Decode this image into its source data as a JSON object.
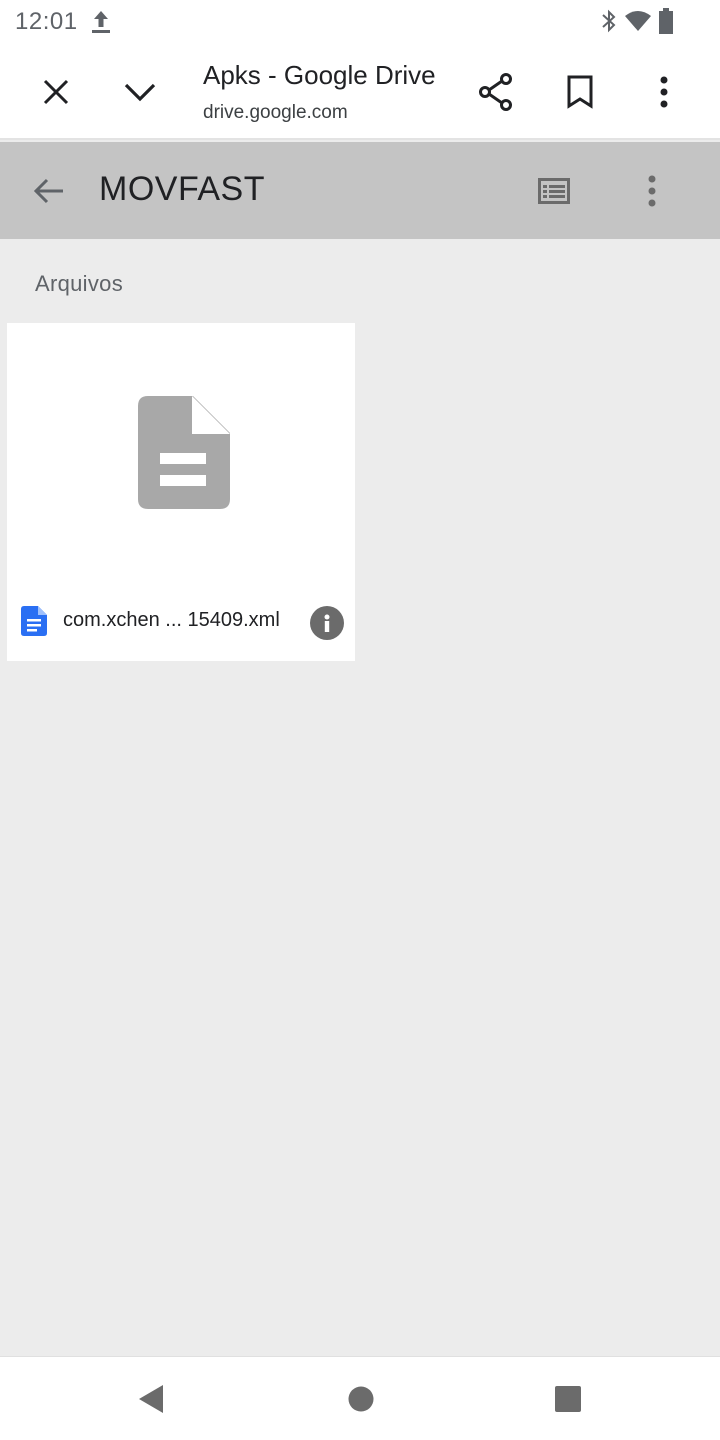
{
  "status_bar": {
    "time": "12:01",
    "icons": [
      "upload-icon",
      "bluetooth-icon",
      "wifi-icon",
      "battery-icon"
    ]
  },
  "custom_tab": {
    "title": "Apks - Google Drive",
    "url": "drive.google.com",
    "icons": [
      "close-icon",
      "chevron-down-icon",
      "share-icon",
      "bookmark-icon",
      "more-vert-icon"
    ]
  },
  "drive_toolbar": {
    "folder_title": "MOVFAST",
    "icons": [
      "back-arrow-icon",
      "list-view-icon",
      "more-vert-icon"
    ]
  },
  "files_section": {
    "label": "Arquivos",
    "items": [
      {
        "name": "com.xchen ... 15409.xml",
        "type_icon": "docs-file-icon",
        "thumbnail_icon": "generic-file-icon"
      }
    ]
  },
  "nav_bar": {
    "icons": [
      "back-triangle-icon",
      "home-circle-icon",
      "recents-square-icon"
    ]
  },
  "colors": {
    "toolbar_gray": "#c4c4c4",
    "background": "#ececec",
    "docs_blue": "#2a6ff3",
    "thumbnail_gray": "#a8a8a8"
  }
}
